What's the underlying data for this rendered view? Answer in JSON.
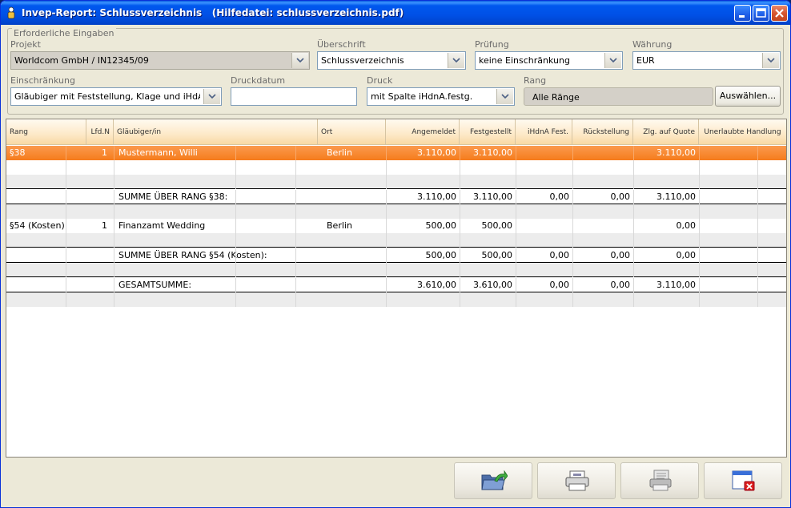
{
  "window": {
    "title": "Invep-Report: Schlussverzeichnis   (Hilfedatei: schlussverzeichnis.pdf)"
  },
  "form": {
    "group_title": "Erforderliche Eingaben",
    "projekt": {
      "label": "Projekt",
      "value": "Worldcom GmbH / IN12345/09"
    },
    "ueberschrift": {
      "label": "Überschrift",
      "value": "Schlussverzeichnis"
    },
    "pruefung": {
      "label": "Prüfung",
      "value": "keine Einschränkung"
    },
    "waehrung": {
      "label": "Währung",
      "value": "EUR"
    },
    "einschraenkung": {
      "label": "Einschränkung",
      "value": "Gläubiger mit Feststellung, Klage und iHdA"
    },
    "druckdatum": {
      "label": "Druckdatum",
      "value": ""
    },
    "druck": {
      "label": "Druck",
      "value": "mit Spalte iHdnA.festg."
    },
    "rang": {
      "label": "Rang",
      "value": "Alle Ränge"
    },
    "auswaehlen_label": "Auswählen..."
  },
  "table": {
    "columns": [
      "Rang",
      "Lfd.N",
      "Gläubiger/in",
      "Ort",
      "Angemeldet",
      "Festgestellt",
      "iHdnA Fest.",
      "Rückstellung",
      "Zlg. auf Quote",
      "Unerlaubte Handlung"
    ],
    "rows": [
      {
        "rang": "§38",
        "lfd": "1",
        "glaeubiger": "Mustermann, Willi",
        "ort": "Berlin",
        "angemeldet": "3.110,00",
        "festgestellt": "3.110,00",
        "ihdna": "",
        "rueck": "",
        "quote": "3.110,00"
      },
      {
        "rang": "",
        "lfd": "",
        "glaeubiger": "SUMME ÜBER RANG §38:",
        "ort": "",
        "angemeldet": "3.110,00",
        "festgestellt": "3.110,00",
        "ihdna": "0,00",
        "rueck": "0,00",
        "quote": "3.110,00"
      },
      {
        "rang": "§54 (Kosten)",
        "lfd": "1",
        "glaeubiger": "Finanzamt Wedding",
        "ort": "Berlin",
        "angemeldet": "500,00",
        "festgestellt": "500,00",
        "ihdna": "",
        "rueck": "",
        "quote": "0,00"
      },
      {
        "rang": "",
        "lfd": "",
        "glaeubiger": "SUMME ÜBER RANG §54 (Kosten):",
        "ort": "",
        "angemeldet": "500,00",
        "festgestellt": "500,00",
        "ihdna": "0,00",
        "rueck": "0,00",
        "quote": "0,00"
      },
      {
        "rang": "",
        "lfd": "",
        "glaeubiger": "GESAMTSUMME:",
        "ort": "",
        "angemeldet": "3.610,00",
        "festgestellt": "3.610,00",
        "ihdna": "0,00",
        "rueck": "0,00",
        "quote": "3.110,00"
      }
    ]
  },
  "toolbar": {
    "buttons": [
      "open-folder-icon",
      "printer-icon",
      "print-preview-icon",
      "close-window-icon"
    ]
  },
  "colors": {
    "selected_row": "#f57c1c",
    "header_bg": "#fde9c8",
    "titlebar": "#0054e3"
  }
}
